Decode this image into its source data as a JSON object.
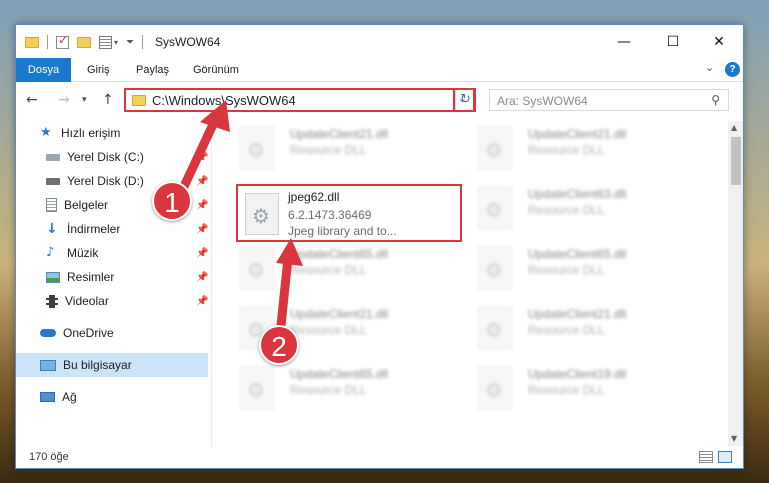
{
  "window": {
    "title": "SysWOW64",
    "buttons": {
      "minimize": "—",
      "maximize": "☐",
      "close": "✕"
    }
  },
  "ribbon": {
    "tabs": [
      "Dosya",
      "Giriş",
      "Paylaş",
      "Görünüm"
    ]
  },
  "navigation": {
    "address": "C:\\Windows\\SysWOW64",
    "search_placeholder": "Ara: SysWOW64"
  },
  "sidebar": {
    "items": [
      {
        "label": "Hızlı erişim",
        "icon": "star-icon",
        "pinned": false
      },
      {
        "label": "Yerel Disk (C:)",
        "icon": "drive-icon",
        "pinned": true
      },
      {
        "label": "Yerel Disk (D:)",
        "icon": "drive-icon",
        "pinned": true
      },
      {
        "label": "Belgeler",
        "icon": "documents-icon",
        "pinned": true
      },
      {
        "label": "İndirmeler",
        "icon": "download-icon",
        "pinned": true
      },
      {
        "label": "Müzik",
        "icon": "music-icon",
        "pinned": true
      },
      {
        "label": "Resimler",
        "icon": "pictures-icon",
        "pinned": true
      },
      {
        "label": "Videolar",
        "icon": "video-icon",
        "pinned": true
      },
      {
        "label": "OneDrive",
        "icon": "cloud-icon",
        "pinned": false
      },
      {
        "label": "Bu bilgisayar",
        "icon": "computer-icon",
        "pinned": false,
        "selected": true
      },
      {
        "label": "Ağ",
        "icon": "network-icon",
        "pinned": false
      }
    ]
  },
  "files": {
    "highlighted": {
      "name": "jpeg62.dll",
      "version": "6.2.1473.36469",
      "description": "Jpeg library and to..."
    },
    "background": [
      {
        "name": "UpdateClient21.dll",
        "type": "Resource DLL"
      },
      {
        "name": "UpdateClient21.dll",
        "type": "Resource DLL"
      },
      {
        "name": "UpdateClient63.dll",
        "type": "Resource DLL"
      },
      {
        "name": "UpdateClient65.dll",
        "type": "Resource DLL"
      },
      {
        "name": "UpdateClient65.dll",
        "type": "Resource DLL"
      },
      {
        "name": "UpdateClient21.dll",
        "type": "Resource DLL"
      },
      {
        "name": "UpdateClient21.dll",
        "type": "Resource DLL"
      },
      {
        "name": "UpdateClient65.dll",
        "type": "Resource DLL"
      },
      {
        "name": "UpdateClient19.dll",
        "type": "Resource DLL"
      }
    ]
  },
  "status": {
    "count": "170 öğe"
  },
  "annotations": {
    "step1": "1",
    "step2": "2",
    "color": "#d9363e"
  }
}
